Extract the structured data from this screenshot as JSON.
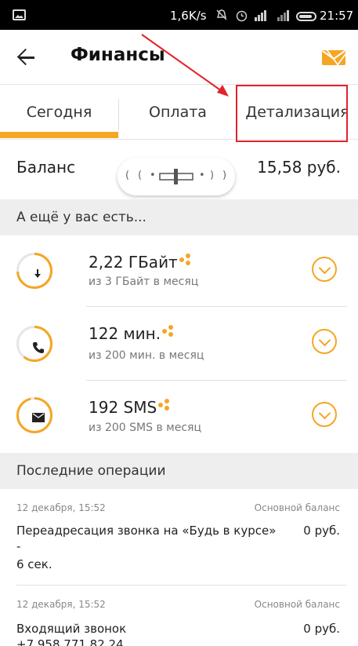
{
  "statusbar": {
    "speed": "1,6K/s",
    "time": "21:57",
    "icons": [
      "image-icon",
      "mute-icon",
      "alarm-icon",
      "signal-icon",
      "battery-icon"
    ]
  },
  "appbar": {
    "title": "Финансы",
    "icons": [
      "back-arrow-icon",
      "mail-icon"
    ]
  },
  "tabs": [
    {
      "label": "Сегодня",
      "active": true
    },
    {
      "label": "Оплата",
      "active": false
    },
    {
      "label": "Детализация",
      "active": false
    }
  ],
  "balance": {
    "label": "Баланс",
    "value": "15,58 руб."
  },
  "packages_header": "А ещё у вас есть...",
  "packages": [
    {
      "amount": "2,22 ГБайт",
      "subtitle": "из 3 ГБайт в месяц",
      "icon": "download-icon",
      "remaining_fraction": 0.74
    },
    {
      "amount": "122 мин.",
      "subtitle": "из 200 мин. в месяц",
      "icon": "phone-icon",
      "remaining_fraction": 0.61
    },
    {
      "amount": "192 SMS",
      "subtitle": "из 200 SMS в месяц",
      "icon": "envelope-icon",
      "remaining_fraction": 0.96
    }
  ],
  "operations_header": "Последние операции",
  "operations": [
    {
      "date": "12 декабря, 15:52",
      "source": "Основной баланс",
      "title": "Переадресация звонка на «Будь в курсе»",
      "extra1": "-",
      "extra2": "6 сек.",
      "amount": "0 руб."
    },
    {
      "date": "12 декабря, 15:52",
      "source": "Основной баланс",
      "title": "Входящий звонок",
      "extra1": "+7 958 771 82 24",
      "amount": "0 руб."
    }
  ],
  "colors": {
    "accent": "#f5a623",
    "annotation": "#e2232a",
    "section_bg": "#eeeeee"
  }
}
